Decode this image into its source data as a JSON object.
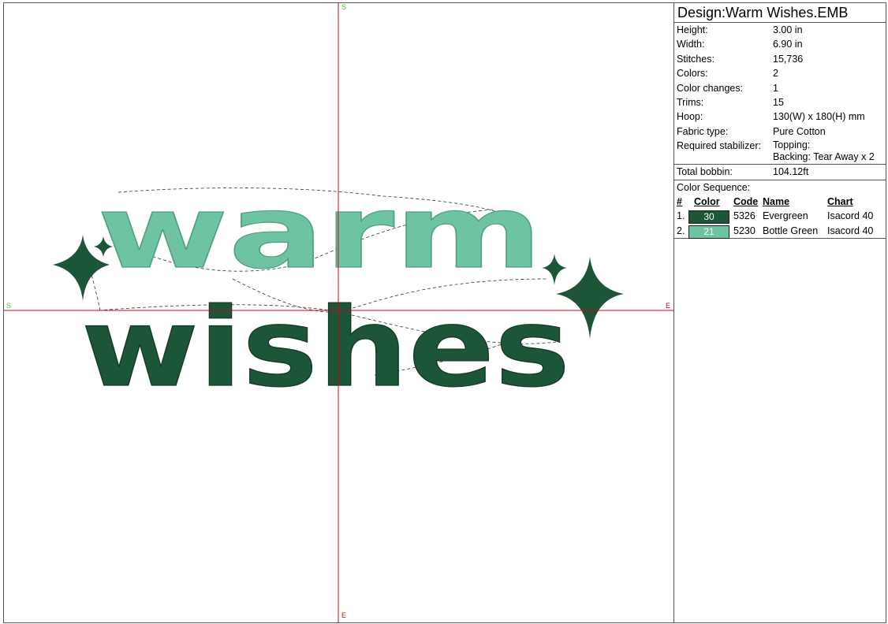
{
  "design": {
    "prefix": "Design:",
    "name": "Warm Wishes.EMB"
  },
  "axis": {
    "north": "S",
    "south": "E",
    "west": "S",
    "east": "E"
  },
  "artwork": {
    "line1": "warm",
    "line2": "wishes"
  },
  "colors": {
    "evergreen": "#1d5538",
    "bottle_green": "#6ec3a2",
    "crosshair": "#d0021b"
  },
  "info": [
    {
      "label": "Height:",
      "value": "3.00 in"
    },
    {
      "label": "Width:",
      "value": "6.90 in"
    },
    {
      "label": "Stitches:",
      "value": "15,736"
    },
    {
      "label": "Colors:",
      "value": "2"
    },
    {
      "label": "Color changes:",
      "value": "1"
    },
    {
      "label": "Trims:",
      "value": "15"
    },
    {
      "label": "Hoop:",
      "value": "130(W) x 180(H) mm"
    },
    {
      "label": "Fabric type:",
      "value": "Pure Cotton"
    }
  ],
  "stabilizer": {
    "label": "Required stabilizer:",
    "topping": "Topping:",
    "backing": "Backing: Tear Away x 2"
  },
  "bobbin": {
    "label": "Total bobbin:",
    "value": "104.12ft"
  },
  "sequence": {
    "title": "Color Sequence:",
    "headers": {
      "num": "#",
      "color": "Color",
      "code": "Code",
      "name": "Name",
      "chart": "Chart"
    },
    "rows": [
      {
        "num": "1.",
        "swatch": "30",
        "code": "5326",
        "name": "Evergreen",
        "chart": "Isacord 40",
        "hex": "#1d5538"
      },
      {
        "num": "2.",
        "swatch": "21",
        "code": "5230",
        "name": "Bottle Green",
        "chart": "Isacord 40",
        "hex": "#6ec3a2"
      }
    ]
  }
}
